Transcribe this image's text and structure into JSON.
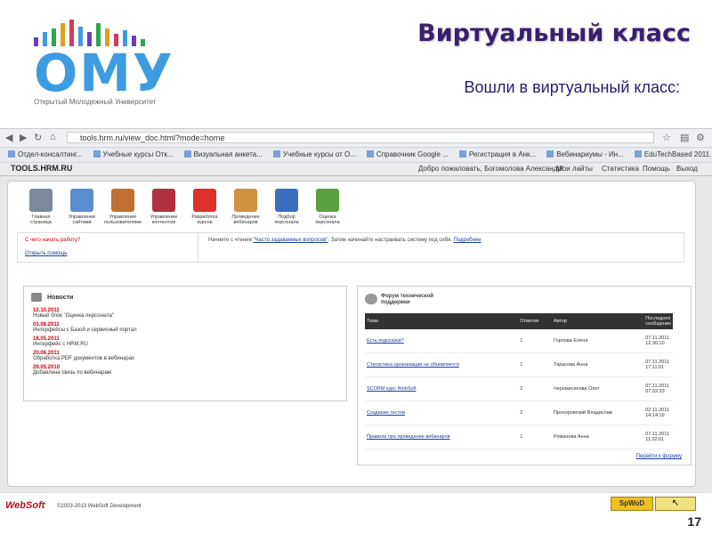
{
  "logo": {
    "text": "ОМУ",
    "subtitle": "Открытый Молодежный Университет",
    "bar_colors": [
      "#6c3ec1",
      "#3d9be0",
      "#2aa84a",
      "#e0a020",
      "#d23c5a",
      "#3d9be0",
      "#6c3ec1",
      "#2aa84a",
      "#e0a020",
      "#d23c5a",
      "#3d9be0",
      "#6c3ec1",
      "#2aa84a"
    ]
  },
  "slide": {
    "title": "Виртуальный класс",
    "subtitle": "Вошли в виртуальный класс:",
    "page_number": "17"
  },
  "browser": {
    "url": "tools.hrm.ru/view_doc.html?mode=home",
    "bookmarks": [
      "Отдел-консалтинг...",
      "Учебные курсы Отк...",
      "Визуальная анкета...",
      "Учебные курсы от О...",
      "Справочник Google ...",
      "Регистрация в Анк...",
      "Вебинариумы - Ин...",
      "EduTechBased 2011..."
    ],
    "site_logo": "TOOLS.HRM.RU",
    "site_links": [
      "Добро пожаловать, Богомолова Александр!",
      "Мои лайты",
      "Статистика",
      "Помощь",
      "Выход"
    ]
  },
  "toolbar": {
    "items": [
      {
        "label": "Главная страница",
        "color": "#7b8a9a"
      },
      {
        "label": "Управление сайтами",
        "color": "#5a8cd0"
      },
      {
        "label": "Управление пользователями",
        "color": "#c07030"
      },
      {
        "label": "Управление контентом",
        "color": "#b03040"
      },
      {
        "label": "Разработка курсов",
        "color": "#e0302a"
      },
      {
        "label": "Проведение вебинаров",
        "color": "#d09040"
      },
      {
        "label": "Подбор персонала",
        "color": "#3a6ec0"
      },
      {
        "label": "Оценка персонала",
        "color": "#5aa040"
      }
    ]
  },
  "welcome": {
    "question": "С чего начать работу?",
    "text_prefix": "Начните с чтения",
    "link_faq": "\"Часто задаваемых вопросов\"",
    "text_mid": ". Затем начинайте настраивать систему под себя.",
    "link_more": "Подробнее",
    "help_link": "Открыть помощь"
  },
  "news": {
    "title": "Новости",
    "items": [
      {
        "date": "12.10.2011",
        "title": "Новый блок \"Оценка персонала\""
      },
      {
        "date": "03.08.2011",
        "title": "Интерфейсы с Базой и сервисный портал"
      },
      {
        "date": "18.05.2011",
        "title": "Интерфейс с HRM.RU"
      },
      {
        "date": "20.06.2011",
        "title": "Обработка PDF документов в вебинарах"
      },
      {
        "date": "29.05.2010",
        "title": "Добавлена связь по вебинарам"
      }
    ]
  },
  "forum": {
    "title": "Форум технической поддержки",
    "headers": [
      "Тема",
      "Ответов",
      "Автор",
      "Последнее сообщение"
    ],
    "rows": [
      {
        "topic": "Есть подсказки?",
        "replies": "1",
        "author": "Горлова Елена",
        "last": "07.11.2011 12:30:10"
      },
      {
        "topic": "Статистика организации не обновляется",
        "replies": "1",
        "author": "Тарасова Анна",
        "last": "07.11.2011 17:11:01"
      },
      {
        "topic": "SCORM курс WebSoft",
        "replies": "2",
        "author": "Черемисинова Олег",
        "last": "07.11.2011 07:32:33"
      },
      {
        "topic": "Создание тестов",
        "replies": "2",
        "author": "Прохоровский Владислав",
        "last": "02.11.2011 14:14:19"
      },
      {
        "topic": "Правила про проведение вебинаров",
        "replies": "1",
        "author": "Романова Анна",
        "last": "07.11.2011 11:32:01"
      }
    ],
    "goto": "Перейти к форуму"
  },
  "footer": {
    "brand": "WebSoft",
    "copyright": "©2003-2013 WebSoft Development",
    "badge": "SpWoD"
  }
}
